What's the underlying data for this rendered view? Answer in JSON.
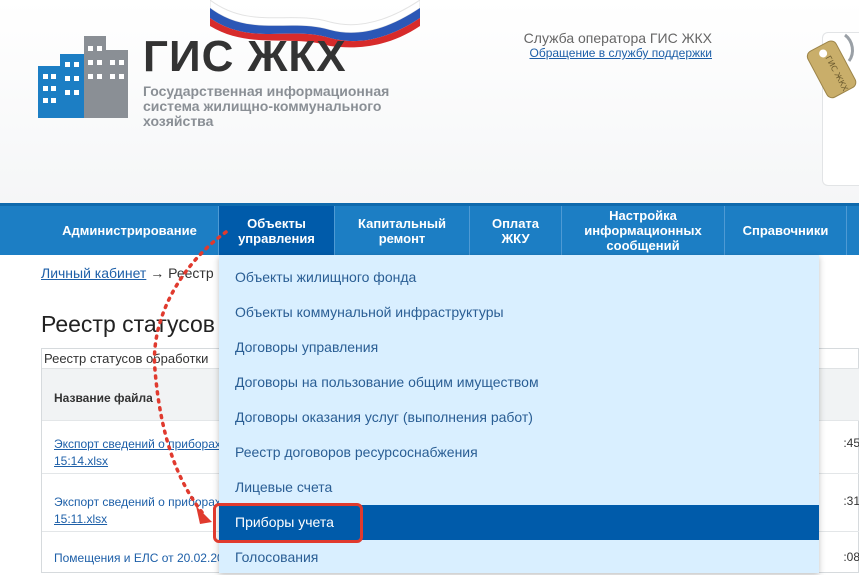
{
  "header": {
    "logo_title": "ГИС ЖКХ",
    "logo_subtitle": "Государственная информационная система жилищно-коммунального хозяйства",
    "support_title": "Служба оператора ГИС ЖКХ",
    "support_link": "Обращение в службу поддержки",
    "key_tag": "ГИС ЖКХ"
  },
  "nav": {
    "items": [
      {
        "label": "Администрирование"
      },
      {
        "label": "Объекты\nуправления"
      },
      {
        "label": "Капитальный\nремонт"
      },
      {
        "label": "Оплата\nЖКУ"
      },
      {
        "label": "Настройка\nинформационных\nсообщений"
      },
      {
        "label": "Справочники"
      }
    ]
  },
  "breadcrumb": {
    "root": "Личный кабинет",
    "separator": "→",
    "current": "Реестр"
  },
  "page": {
    "title": "Реестр статусов"
  },
  "panel": {
    "caption": "Реестр статусов обработки",
    "column_name": "Название файла",
    "rows": [
      {
        "line1": "Экспорт сведений о приборах",
        "line2": "15:14.xlsx",
        "time": ":45"
      },
      {
        "line1": "Экспорт сведений о приборах",
        "line2": "15:11.xlsx",
        "time": ":31"
      },
      {
        "line1": "Помещения и ЕЛС от 20.02.20",
        "line2": "",
        "time": ":08"
      }
    ]
  },
  "dropdown": {
    "items": [
      {
        "label": "Объекты жилищного фонда"
      },
      {
        "label": "Объекты коммунальной инфраструктуры"
      },
      {
        "label": "Договоры управления"
      },
      {
        "label": "Договоры на пользование общим имуществом"
      },
      {
        "label": "Договоры оказания услуг (выполнения работ)"
      },
      {
        "label": "Реестр договоров ресурсоснабжения"
      },
      {
        "label": "Лицевые счета"
      },
      {
        "label": "Приборы учета"
      },
      {
        "label": "Голосования"
      }
    ]
  },
  "colors": {
    "nav_bg": "#1c7ec4",
    "nav_active": "#005baa",
    "dropdown_bg": "#d9efff",
    "highlight": "#e03a2e",
    "link": "#1d5fa8"
  }
}
